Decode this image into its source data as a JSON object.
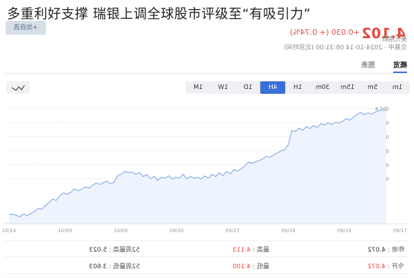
{
  "headline": "多重利好支撑 瑞银上调全球股市评级至“有吸引力”",
  "quote": {
    "price": "4.102",
    "change": "+0.030 (+ 0.74%)",
    "status": "交易中 · 2024-10-14 08:31:00 (北京时间)",
    "exchange": "美元指数",
    "follow_label": "+加自选"
  },
  "tabs": [
    {
      "label": "概览",
      "active": true
    },
    {
      "label": "图表",
      "active": false
    }
  ],
  "periods": [
    {
      "label": "1m",
      "active": false
    },
    {
      "label": "5m",
      "active": false
    },
    {
      "label": "15m",
      "active": false
    },
    {
      "label": "30m",
      "active": false
    },
    {
      "label": "1H",
      "active": false
    },
    {
      "label": "4H",
      "active": true
    },
    {
      "label": "1D",
      "active": false
    },
    {
      "label": "1W",
      "active": false
    },
    {
      "label": "1M",
      "active": false
    }
  ],
  "chart_type_icon": "line-chart-icon",
  "chart_data": {
    "type": "line",
    "x_tick_labels": [
      "10/14",
      "10/09",
      "10/05",
      "09/30",
      "09/27",
      "09/24",
      "09/19",
      "09/17"
    ],
    "y_ticks": [
      4.1,
      4.05,
      4.0,
      3.95,
      3.9,
      3.85
    ],
    "y_tick_labels": [
      "4.100",
      "4.050",
      "4.000",
      "3.950",
      "3.900",
      "3.850"
    ],
    "ylim": [
      3.69,
      4.11
    ],
    "grid": true,
    "color": "#8fb3e8",
    "values": [
      4.093,
      4.095,
      4.092,
      4.087,
      4.08,
      4.084,
      4.078,
      4.086,
      4.079,
      4.07,
      4.058,
      4.064,
      4.055,
      4.048,
      4.051,
      4.043,
      4.049,
      4.041,
      4.046,
      4.032,
      4.039,
      4.029,
      4.036,
      4.022,
      4.03,
      4.018,
      4.022,
      3.972,
      3.953,
      3.95,
      3.942,
      3.935,
      3.927,
      3.93,
      3.921,
      3.915,
      3.911,
      3.905,
      3.909,
      3.895,
      3.885,
      3.878,
      3.882,
      3.868,
      3.876,
      3.862,
      3.871,
      3.858,
      3.866,
      3.852,
      3.86,
      3.849,
      3.855,
      3.852,
      3.858,
      3.85,
      3.866,
      3.853,
      3.855,
      3.849,
      3.861,
      3.852,
      3.856,
      3.845,
      3.859,
      3.85,
      3.865,
      3.858,
      3.872,
      3.866,
      3.874,
      3.872,
      3.876,
      3.866,
      3.862,
      3.838,
      3.832,
      3.842,
      3.836,
      3.83,
      3.835,
      3.826,
      3.817,
      3.821,
      3.812,
      3.808,
      3.814,
      3.802,
      3.795,
      3.8,
      3.79,
      3.773,
      3.778,
      3.765,
      3.755,
      3.741,
      3.745,
      3.733,
      3.727,
      3.719,
      3.725,
      3.715,
      3.72,
      3.724,
      3.723
    ]
  },
  "stats": [
    {
      "label": "昨收",
      "value": "4.072",
      "red": false
    },
    {
      "label": "最高",
      "value": "4.113",
      "red": true
    },
    {
      "label": "52周最高",
      "value": "5.023",
      "red": false
    },
    {
      "label": "今开",
      "value": "4.072",
      "red": true
    },
    {
      "label": "最低",
      "value": "4.100",
      "red": true
    },
    {
      "label": "52周最低",
      "value": "3.603",
      "red": false
    }
  ]
}
